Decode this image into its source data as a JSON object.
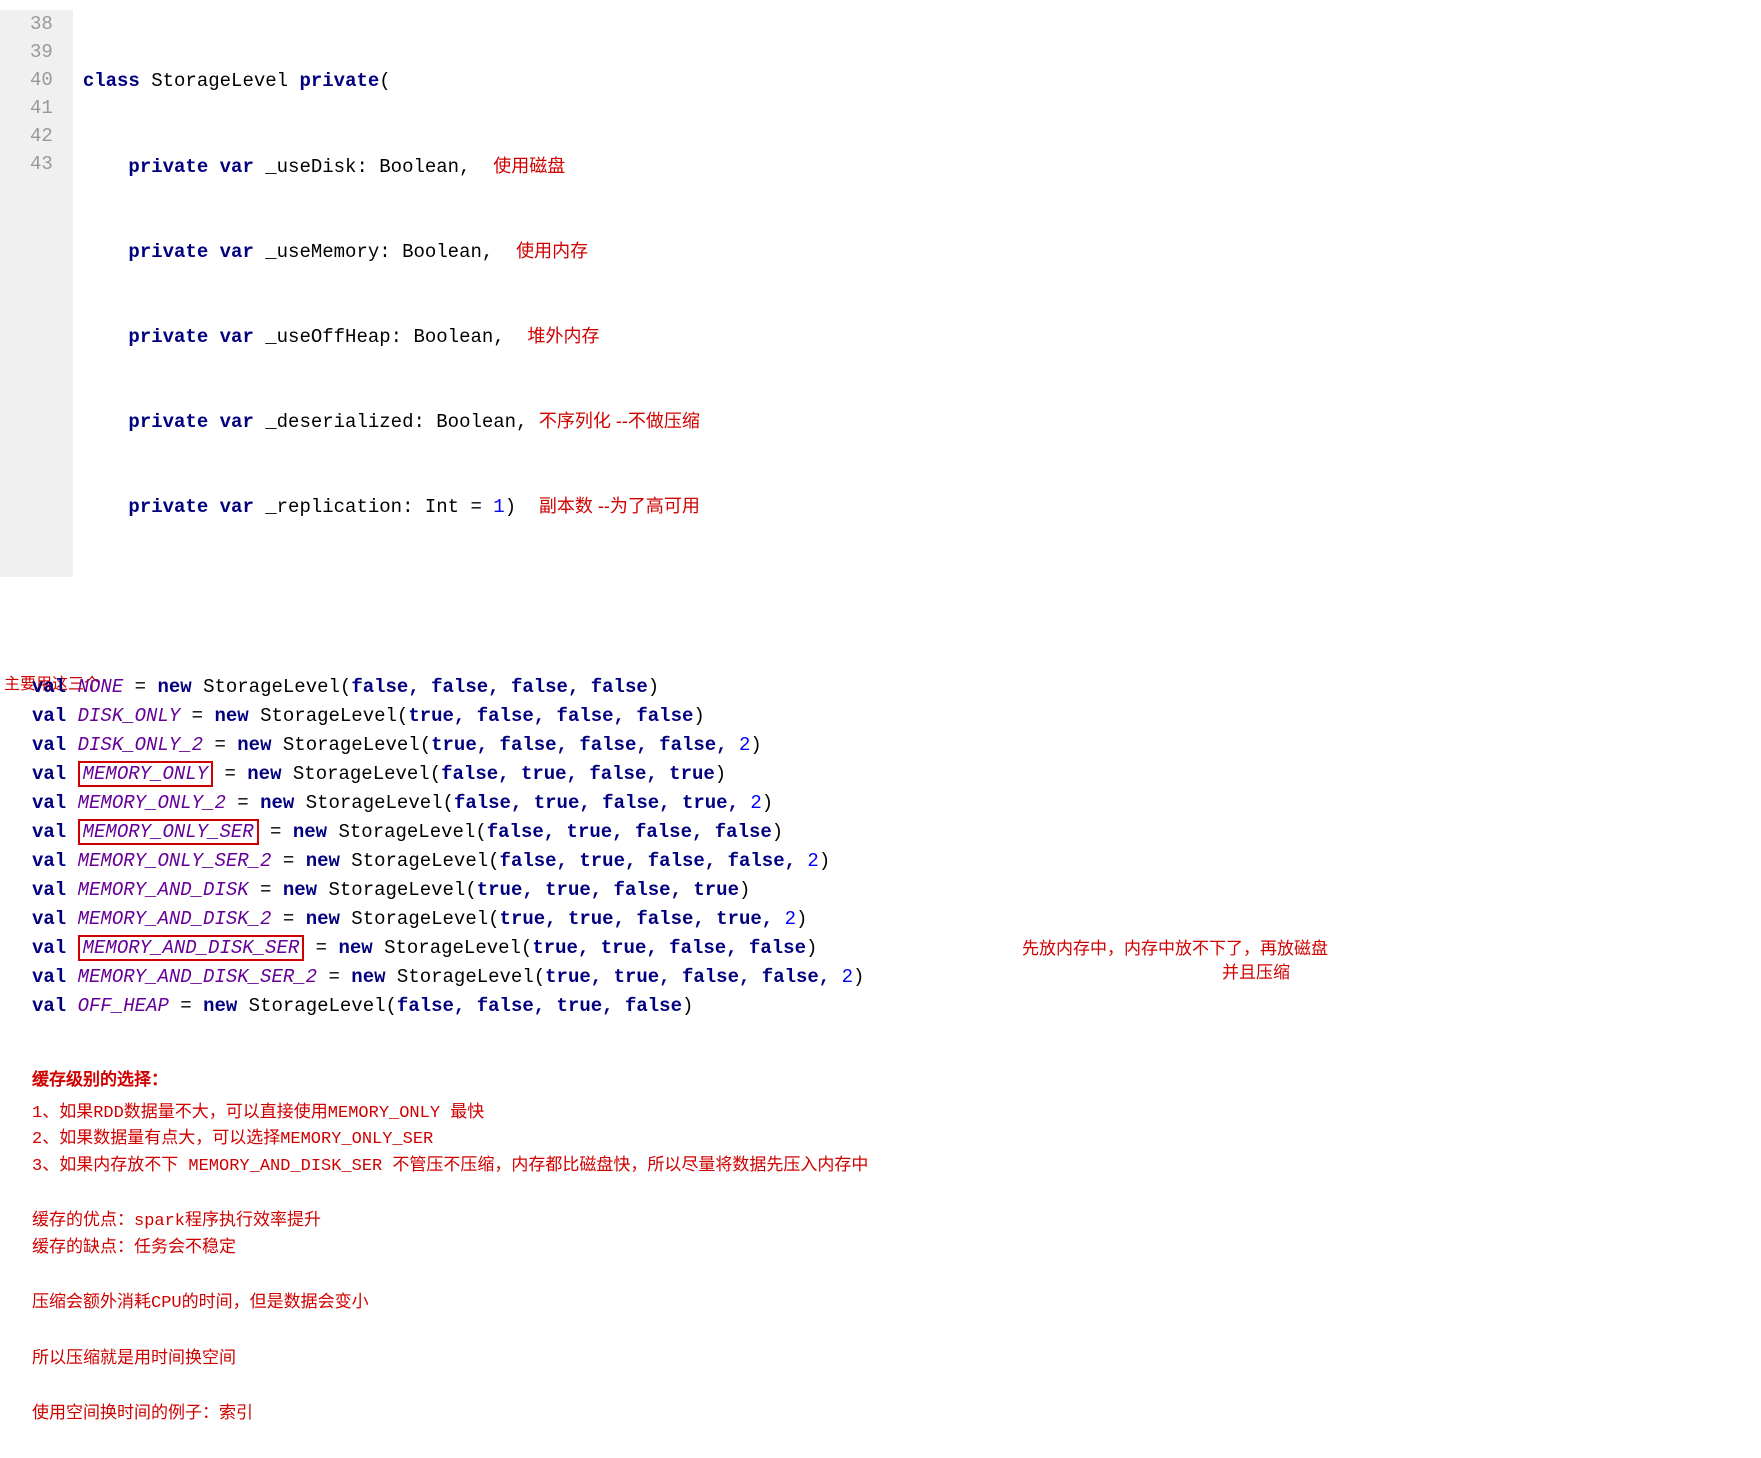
{
  "gutter": [
    "38",
    "39",
    "40",
    "41",
    "42",
    "43"
  ],
  "class_header": {
    "l1_a": "class",
    "l1_b": " StorageLevel ",
    "l1_c": "private",
    "l1_d": "(",
    "l2_a": "private var",
    "l2_b": " _useDisk: Boolean,",
    "l2_note": "使用磁盘",
    "l3_a": "private var",
    "l3_b": " _useMemory: Boolean,",
    "l3_note": "使用内存",
    "l4_a": "private var",
    "l4_b": " _useOffHeap: Boolean,",
    "l4_note": "堆外内存",
    "l5_a": "private var",
    "l5_b": " _deserialized: Boolean,",
    "l5_note": "不序列化 --不做压缩",
    "l6_a": "private var",
    "l6_b": " _replication: Int = ",
    "l6_num": "1",
    "l6_c": ")",
    "l6_note": "副本数 --为了高可用"
  },
  "side_label": "主要用这三个",
  "vals": [
    {
      "name": "NONE",
      "rest": " = ",
      "new": "new",
      "sig": " StorageLevel(",
      "args": "false, false, false, false",
      "end": ")",
      "boxed": false
    },
    {
      "name": "DISK_ONLY",
      "rest": " = ",
      "new": "new",
      "sig": " StorageLevel(",
      "args": "true, false, false, false",
      "end": ")",
      "boxed": false
    },
    {
      "name": "DISK_ONLY_2",
      "rest": " = ",
      "new": "new",
      "sig": " StorageLevel(",
      "args": "true, false, false, false, ",
      "end": ")",
      "num": "2",
      "boxed": false
    },
    {
      "name": "MEMORY_ONLY",
      "rest": " = ",
      "new": "new",
      "sig": " StorageLevel(",
      "args": "false, true, false, true",
      "end": ")",
      "boxed": true
    },
    {
      "name": "MEMORY_ONLY_2",
      "rest": " = ",
      "new": "new",
      "sig": " StorageLevel(",
      "args": "false, true, false, true, ",
      "end": ")",
      "num": "2",
      "boxed": false
    },
    {
      "name": "MEMORY_ONLY_SER",
      "rest": " = ",
      "new": "new",
      "sig": " StorageLevel(",
      "args": "false, true, false, false",
      "end": ")",
      "boxed": true
    },
    {
      "name": "MEMORY_ONLY_SER_2",
      "rest": " = ",
      "new": "new",
      "sig": " StorageLevel(",
      "args": "false, true, false, false, ",
      "end": ")",
      "num": "2",
      "boxed": false
    },
    {
      "name": "MEMORY_AND_DISK",
      "rest": " = ",
      "new": "new",
      "sig": " StorageLevel(",
      "args": "true, true, false, true",
      "end": ")",
      "boxed": false
    },
    {
      "name": "MEMORY_AND_DISK_2",
      "rest": " = ",
      "new": "new",
      "sig": " StorageLevel(",
      "args": "true, true, false, true, ",
      "end": ")",
      "num": "2",
      "boxed": false
    },
    {
      "name": "MEMORY_AND_DISK_SER",
      "rest": " = ",
      "new": "new",
      "sig": " StorageLevel(",
      "args": "true, true, false, false",
      "end": ")",
      "boxed": true,
      "note1": "先放内存中，内存中放不下了，再放磁盘",
      "note2": "并且压缩"
    },
    {
      "name": "MEMORY_AND_DISK_SER_2",
      "rest": " = ",
      "new": "new",
      "sig": " StorageLevel(",
      "args": "true, true, false, false, ",
      "end": ")",
      "num": "2",
      "boxed": false
    },
    {
      "name": "OFF_HEAP",
      "rest": " = ",
      "new": "new",
      "sig": " StorageLevel(",
      "args": "false, false, true, false",
      "end": ")",
      "boxed": false
    }
  ],
  "notes": {
    "title": "缓存级别的选择：",
    "items": [
      "1、如果RDD数据量不大，可以直接使用MEMORY_ONLY   最快",
      "2、如果数据量有点大，可以选择MEMORY_ONLY_SER",
      "3、如果内存放不下 MEMORY_AND_DISK_SER 不管压不压缩，内存都比磁盘快，所以尽量将数据先压入内存中"
    ],
    "adv": "缓存的优点：spark程序执行效率提升",
    "dis": "缓存的缺点：任务会不稳定",
    "p1": "压缩会额外消耗CPU的时间，但是数据会变小",
    "p2": "所以压缩就是用时间换空间",
    "p3": "使用空间换时间的例子：索引"
  }
}
